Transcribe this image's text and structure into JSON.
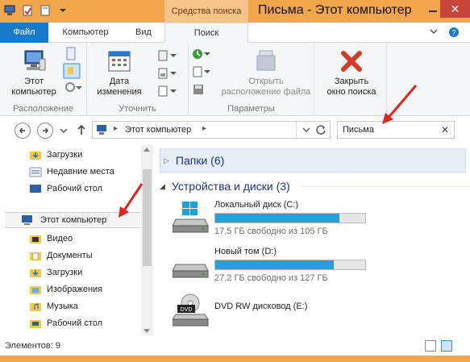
{
  "window": {
    "title": "Письма - Этот компьютер",
    "context_tab": "Средства поиска",
    "close_glyph": "✕"
  },
  "tabs": {
    "file": "Файл",
    "computer": "Компьютер",
    "view": "Вид",
    "search": "Поиск"
  },
  "ribbon": {
    "location": {
      "label": "Расположение",
      "this_pc_line1": "Этот",
      "this_pc_line2": "компьютер"
    },
    "refine": {
      "label": "Уточнить",
      "date_line1": "Дата",
      "date_line2": "изменения"
    },
    "options": {
      "label": "Параметры",
      "open_line1": "Открыть",
      "open_line2": "расположение файла"
    },
    "close": {
      "line1": "Закрыть",
      "line2": "окно поиска"
    }
  },
  "address": {
    "path": "Этот компьютер",
    "search_value": "Письма"
  },
  "nav": {
    "items_top": [
      "Загрузки",
      "Недавние места",
      "Рабочий стол"
    ],
    "this_pc": "Этот компьютер",
    "children": [
      "Видео",
      "Документы",
      "Загрузки",
      "Изображения",
      "Музыка",
      "Рабочий стол"
    ]
  },
  "content": {
    "folders_header": "Папки (6)",
    "devices_header": "Устройства и диски (3)",
    "drives": [
      {
        "name": "Локальный диск (C:)",
        "free": "17,5 ГБ свободно из 105 ГБ",
        "used_fraction": 0.83
      },
      {
        "name": "Новый том (D:)",
        "free": "27,2 ГБ свободно из 127 ГБ",
        "used_fraction": 0.79
      },
      {
        "name": "DVD RW дисковод (E:)"
      }
    ]
  },
  "status": {
    "items": "Элементов: 9"
  },
  "colors": {
    "title_bar": "#f2a64b",
    "file_tab": "#1979ca",
    "close_button": "#c7453b",
    "drive_fill": "#26a0da",
    "annotation_arrow": "#e0231c"
  }
}
